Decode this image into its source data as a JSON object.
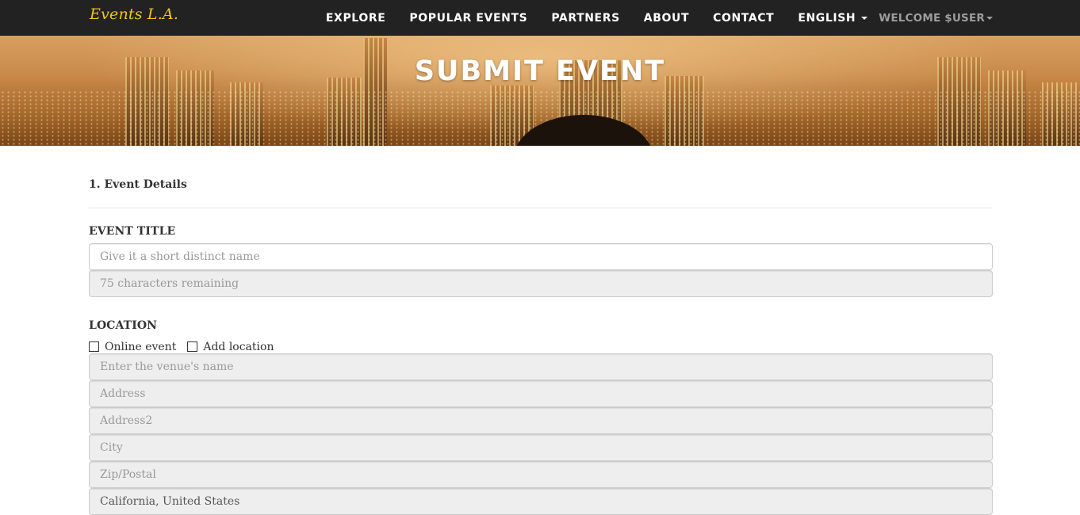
{
  "navbar": {
    "brand": "Events L.A.",
    "links": [
      "EXPLORE",
      "POPULAR EVENTS",
      "PARTNERS",
      "ABOUT",
      "CONTACT"
    ],
    "language": "ENGLISH",
    "welcome": "WELCOME $USER"
  },
  "hero": {
    "title": "SUBMIT EVENT"
  },
  "form": {
    "section": "1. Event Details",
    "title_label": "EVENT TITLE",
    "title_placeholder": "Give it a short distinct name",
    "remaining_placeholder": "75 characters remaining",
    "location_label": "LOCATION",
    "online_label": "Online event",
    "add_location_label": "Add location",
    "venue_placeholder": "Enter the venue's name",
    "address_placeholder": "Address",
    "address2_placeholder": "Address2",
    "city_placeholder": "City",
    "zip_placeholder": "Zip/Postal",
    "region_value": "California, United States"
  }
}
